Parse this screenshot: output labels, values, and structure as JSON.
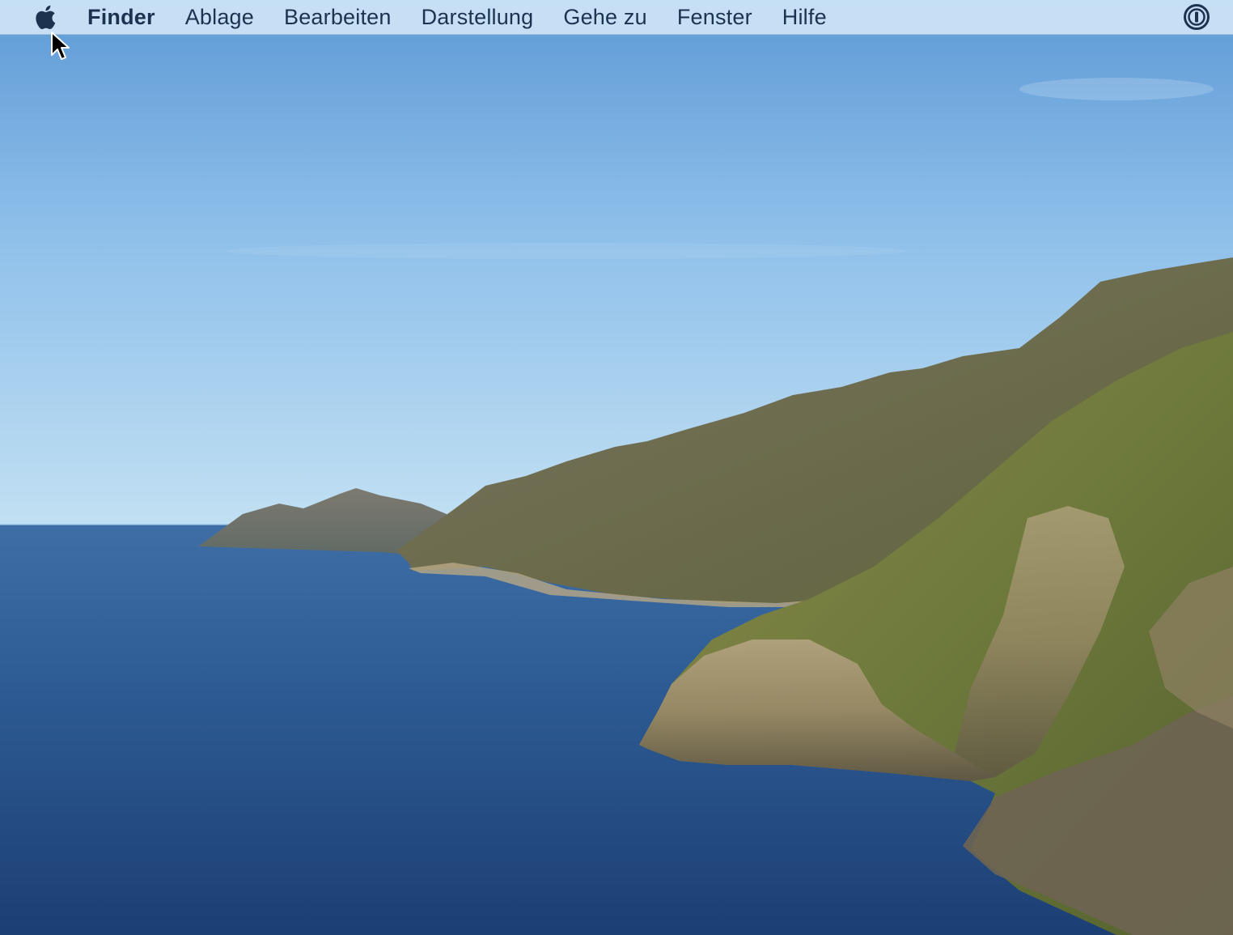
{
  "menubar": {
    "apple_menu_icon": "apple-logo-icon",
    "items": [
      {
        "label": "Finder",
        "bold": true
      },
      {
        "label": "Ablage"
      },
      {
        "label": "Bearbeiten"
      },
      {
        "label": "Darstellung"
      },
      {
        "label": "Gehe zu"
      },
      {
        "label": "Fenster"
      },
      {
        "label": "Hilfe"
      }
    ],
    "status_icons": [
      "password-manager-icon"
    ]
  },
  "desktop": {
    "wallpaper": "coastal-cliffs-ocean"
  },
  "colors": {
    "menubar_bg": "#cee4f6",
    "menu_text": "#1c3350",
    "sky_top": "#6fa9df",
    "sky_horizon": "#b9dcf2",
    "sea": "#24487a"
  }
}
